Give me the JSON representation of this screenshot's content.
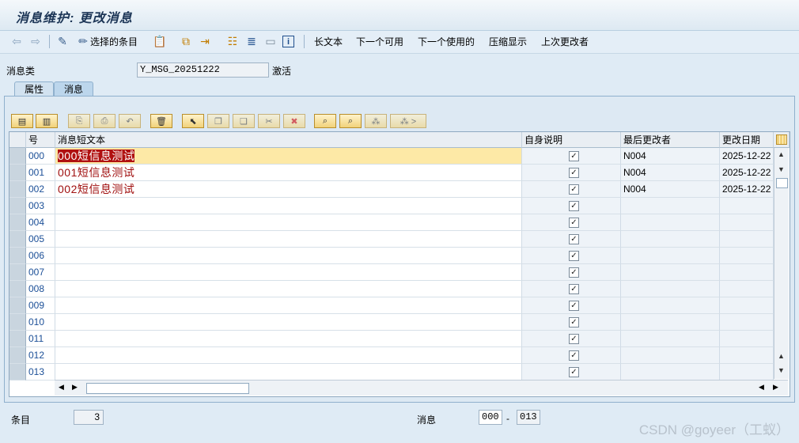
{
  "window": {
    "title": "消息维护: 更改消息"
  },
  "toolbar": {
    "select_entries": "选择的条目",
    "long_text": "长文本",
    "next_available": "下一个可用",
    "next_used": "下一个使用的",
    "compress": "压缩显示",
    "last_changer": "上次更改者"
  },
  "header": {
    "class_label": "消息类",
    "class_value": "Y_MSG_20251222",
    "status": "激活"
  },
  "tabs": [
    "属性",
    "消息"
  ],
  "table": {
    "columns": [
      "号",
      "消息短文本",
      "自身说明",
      "最后更改者",
      "更改日期"
    ],
    "rows": [
      {
        "num": "000",
        "text": "000短信息测试",
        "self": "✓",
        "changer": "N004",
        "date": "2025-12-22"
      },
      {
        "num": "001",
        "text": "001短信息测试",
        "self": "✓",
        "changer": "N004",
        "date": "2025-12-22"
      },
      {
        "num": "002",
        "text": "002短信息测试",
        "self": "✓",
        "changer": "N004",
        "date": "2025-12-22"
      },
      {
        "num": "003",
        "text": "",
        "self": "✓",
        "changer": "",
        "date": ""
      },
      {
        "num": "004",
        "text": "",
        "self": "✓",
        "changer": "",
        "date": ""
      },
      {
        "num": "005",
        "text": "",
        "self": "✓",
        "changer": "",
        "date": ""
      },
      {
        "num": "006",
        "text": "",
        "self": "✓",
        "changer": "",
        "date": ""
      },
      {
        "num": "007",
        "text": "",
        "self": "✓",
        "changer": "",
        "date": ""
      },
      {
        "num": "008",
        "text": "",
        "self": "✓",
        "changer": "",
        "date": ""
      },
      {
        "num": "009",
        "text": "",
        "self": "✓",
        "changer": "",
        "date": ""
      },
      {
        "num": "010",
        "text": "",
        "self": "✓",
        "changer": "",
        "date": ""
      },
      {
        "num": "011",
        "text": "",
        "self": "✓",
        "changer": "",
        "date": ""
      },
      {
        "num": "012",
        "text": "",
        "self": "✓",
        "changer": "",
        "date": ""
      },
      {
        "num": "013",
        "text": "",
        "self": "✓",
        "changer": "",
        "date": ""
      }
    ]
  },
  "footer": {
    "entries_label": "条目",
    "entries_value": "3",
    "messages_label": "消息",
    "msg_from": "000",
    "msg_dash": "-",
    "msg_to": "013"
  },
  "watermark": "CSDN @goyeer（工蚁）",
  "colors": {
    "accent": "#1b4f97",
    "text_red": "#a01010",
    "selected_row": "#fde9a6",
    "highlight": "#b01010"
  }
}
